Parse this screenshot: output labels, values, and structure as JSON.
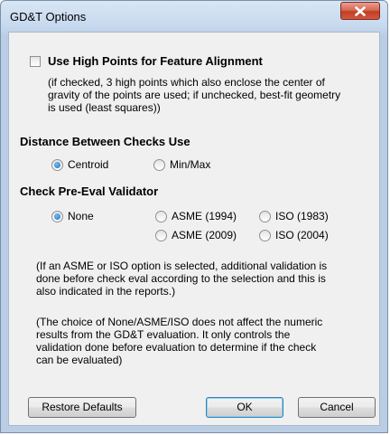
{
  "window": {
    "title": "GD&T Options"
  },
  "high_points": {
    "label": "Use High Points for Feature Alignment",
    "checked": false,
    "description": [
      "(if checked, 3 high points which also enclose the center of",
      "gravity of the points are used; if unchecked, best-fit geometry",
      "is used (least squares))"
    ]
  },
  "distance": {
    "heading": "Distance Between Checks Use",
    "options": [
      {
        "label": "Centroid",
        "selected": true
      },
      {
        "label": "Min/Max",
        "selected": false
      }
    ]
  },
  "validator": {
    "heading": "Check Pre-Eval Validator",
    "options": [
      {
        "label": "None",
        "selected": true
      },
      {
        "label": "ASME (1994)",
        "selected": false
      },
      {
        "label": "ISO (1983)",
        "selected": false
      },
      {
        "label": "ASME (2009)",
        "selected": false
      },
      {
        "label": "ISO (2004)",
        "selected": false
      }
    ],
    "note1": [
      "(If an ASME or ISO option is selected, additional validation is",
      "done before check eval according to the selection and this is",
      "also indicated in the reports.)"
    ],
    "note2": [
      "(The choice of None/ASME/ISO does not affect the numeric",
      "results from the GD&T evaluation.  It only controls the",
      "validation done before evaluation to determine if the check",
      "can be evaluated)"
    ]
  },
  "buttons": {
    "restore": "Restore Defaults",
    "ok": "OK",
    "cancel": "Cancel"
  }
}
